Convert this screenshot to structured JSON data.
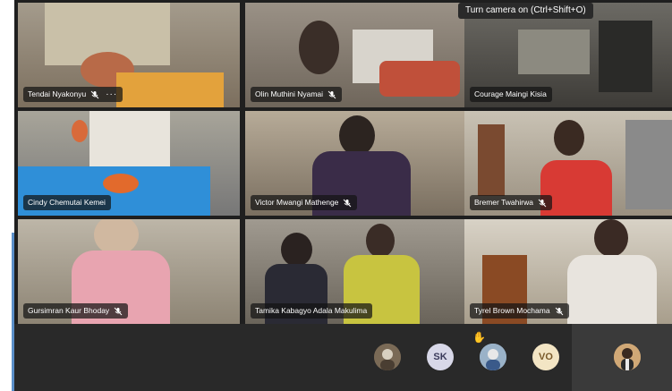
{
  "tooltip": "Turn camera on (Ctrl+Shift+O)",
  "participants": [
    {
      "name": "Tendai Nyakonyu",
      "muted": true,
      "more": "···"
    },
    {
      "name": "Olin Muthini Nyamai",
      "muted": true
    },
    {
      "name": "Courage Maingi Kisia",
      "muted": false
    },
    {
      "name": "Cindy Chemutai Kemei",
      "muted": false
    },
    {
      "name": "Victor Mwangi Mathenge",
      "muted": true
    },
    {
      "name": "Bremer Twahirwa",
      "muted": true
    },
    {
      "name": "Gursimran Kaur Bhoday",
      "muted": true
    },
    {
      "name": "Tamika Kabagyo Adala Makulima",
      "muted": false
    },
    {
      "name": "Tyrel Brown Mochama",
      "muted": true
    }
  ],
  "roster": [
    {
      "type": "photo",
      "icon": "user-photo-icon"
    },
    {
      "initials": "SK",
      "color": "#d8d8e8"
    },
    {
      "type": "photo",
      "icon": "user-photo-icon",
      "hand_raised": true
    },
    {
      "initials": "VO",
      "color": "#f3e5c4"
    }
  ],
  "self_view": {
    "icon": "self-avatar-icon"
  },
  "colors": {
    "chip_bg": "#1a1a1a",
    "bar_bg": "#292929",
    "hand": "#e8b84a"
  }
}
